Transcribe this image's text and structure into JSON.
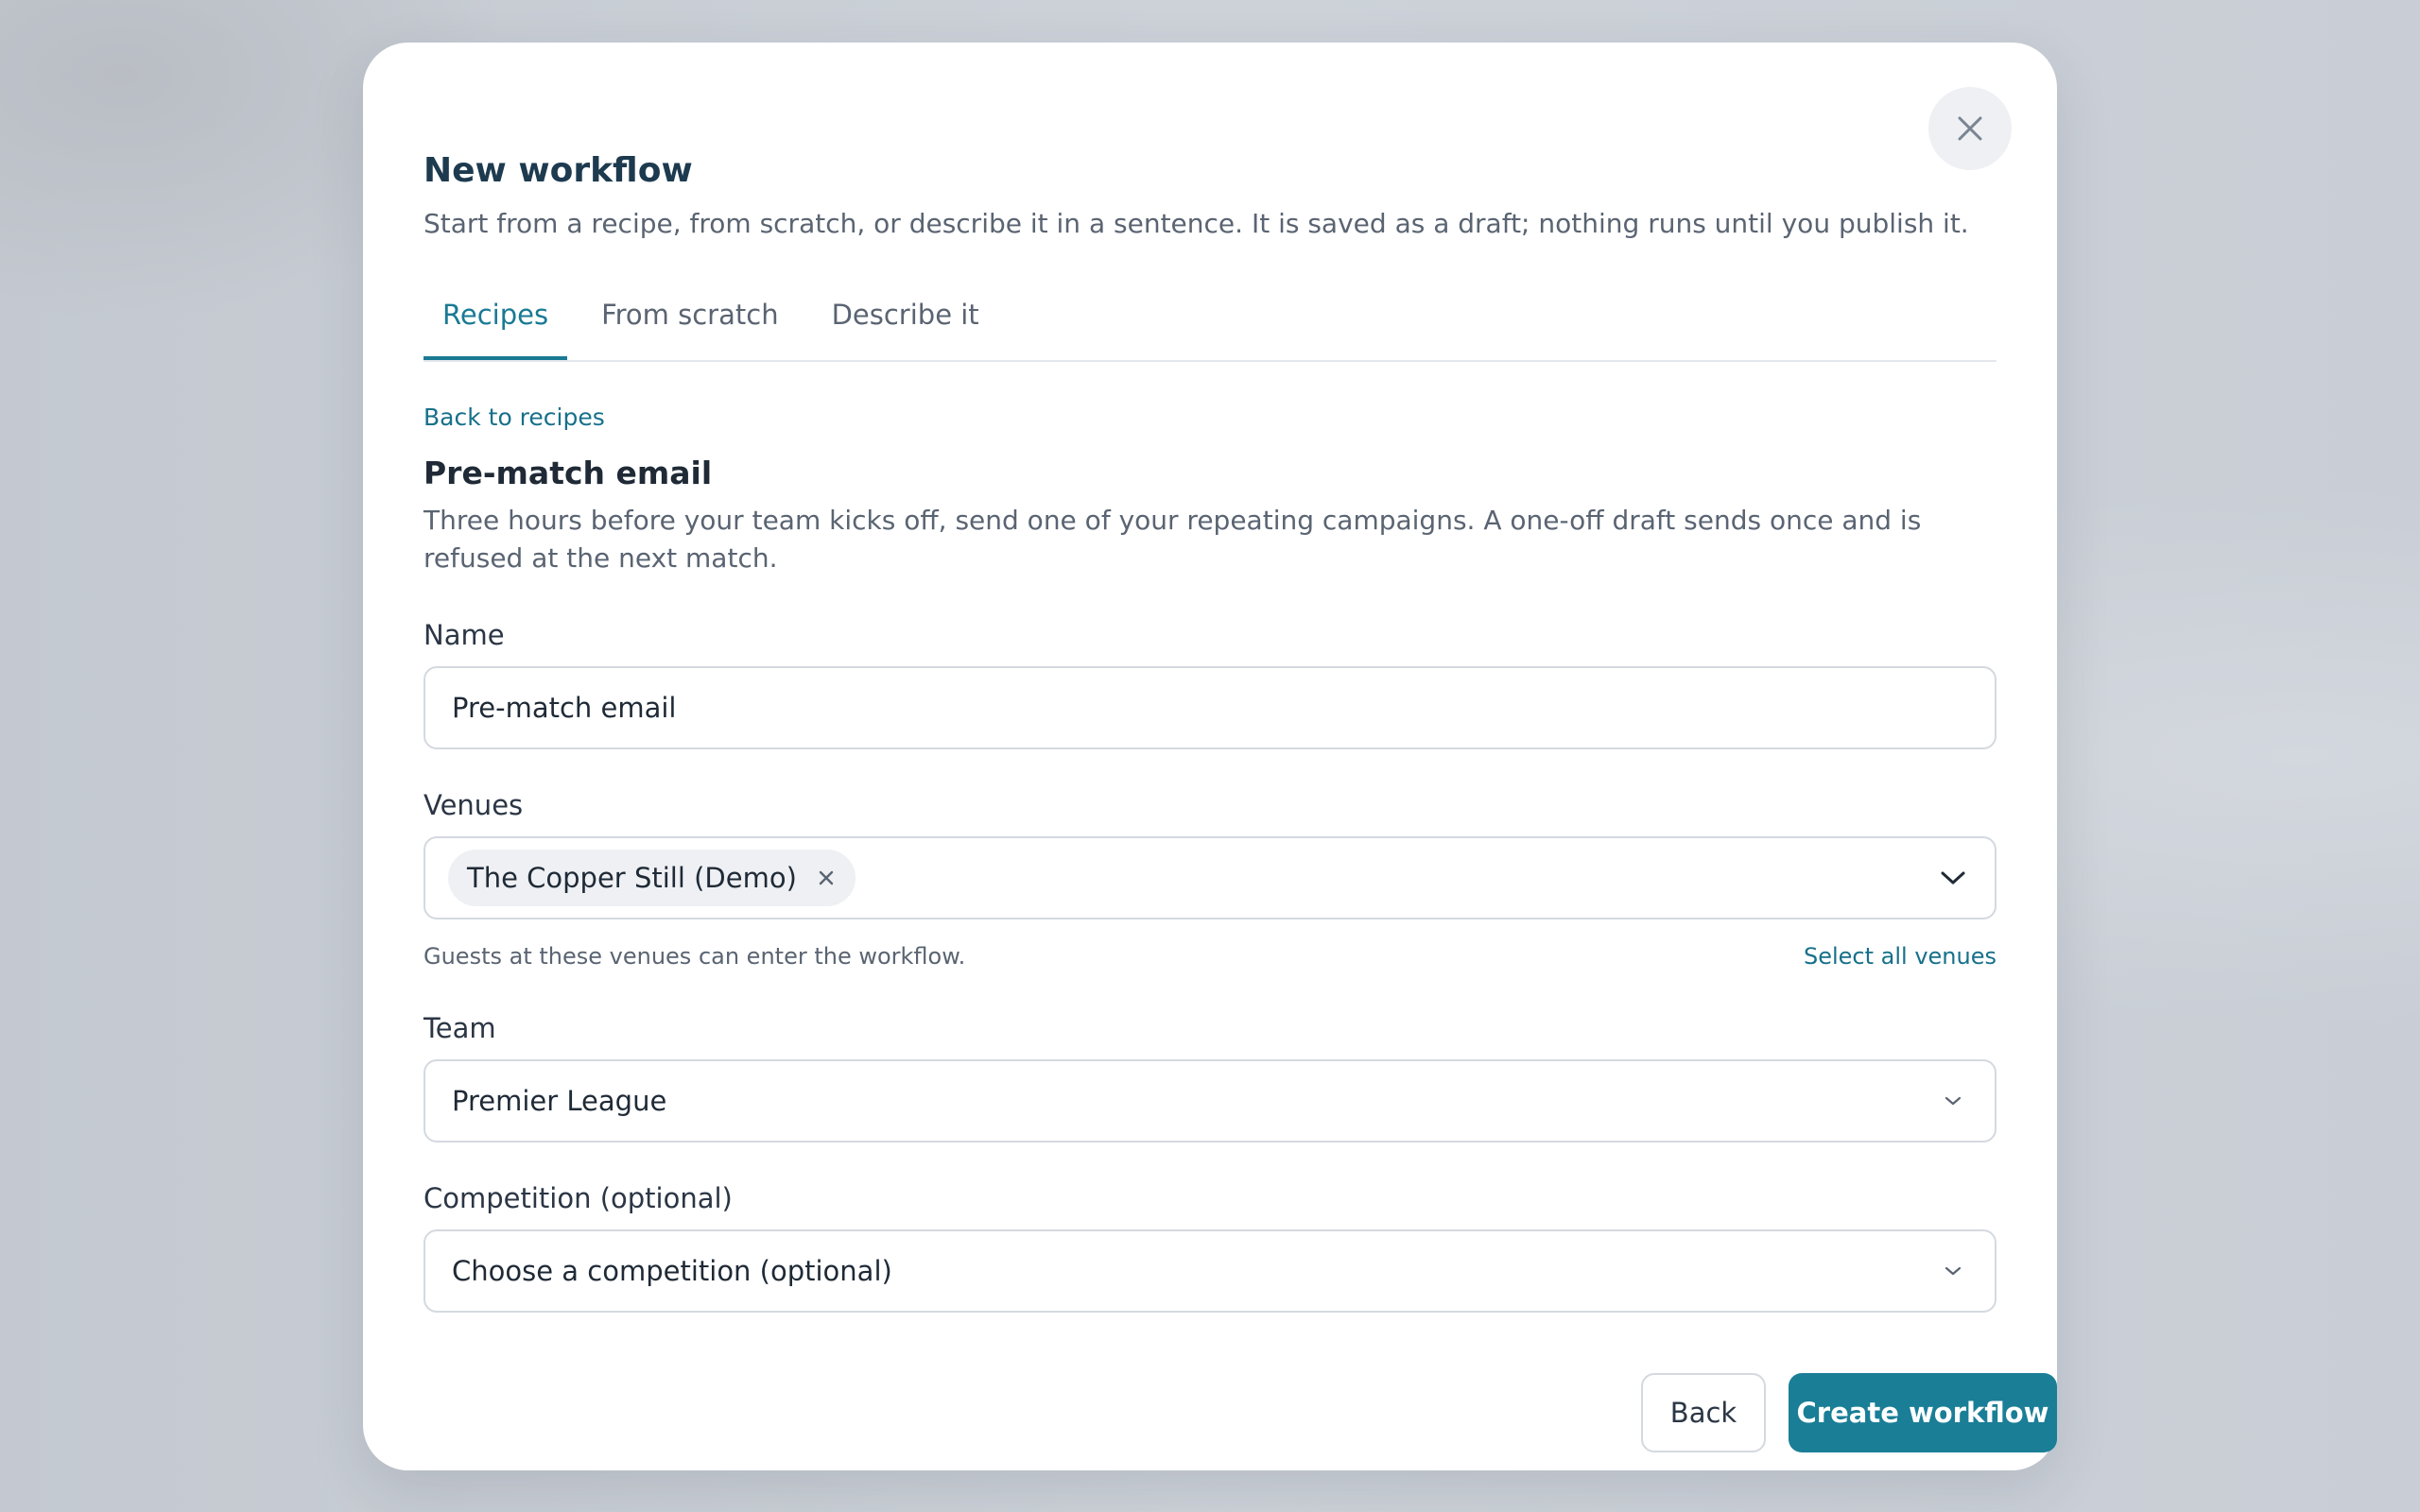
{
  "modal": {
    "title": "New workflow",
    "subtitle": "Start from a recipe, from scratch, or describe it in a sentence. It is saved as a draft; nothing runs until you publish it."
  },
  "tabs": [
    {
      "label": "Recipes",
      "active": true
    },
    {
      "label": "From scratch",
      "active": false
    },
    {
      "label": "Describe it",
      "active": false
    }
  ],
  "back_link": "Back to recipes",
  "recipe": {
    "title": "Pre-match email",
    "description": "Three hours before your team kicks off, send one of your repeating campaigns. A one-off draft sends once and is refused at the next match."
  },
  "form": {
    "name": {
      "label": "Name",
      "value": "Pre-match email"
    },
    "venues": {
      "label": "Venues",
      "selected": [
        "The Copper Still (Demo)"
      ],
      "helper": "Guests at these venues can enter the workflow.",
      "select_all": "Select all venues"
    },
    "team": {
      "label": "Team",
      "value": "Premier League"
    },
    "competition": {
      "label": "Competition (optional)",
      "placeholder": "Choose a competition (optional)"
    }
  },
  "actions": {
    "back": "Back",
    "create": "Create workflow"
  },
  "icons": {
    "close": "close-icon",
    "chip_remove": "x-icon",
    "venues_dropdown": "chevron-down-icon",
    "select_dropdown": "chevron-down-icon"
  },
  "colors": {
    "accent": "#1a7e97",
    "link": "#17708a",
    "title": "#1d3a4f",
    "backdrop": "#c9ced6"
  }
}
